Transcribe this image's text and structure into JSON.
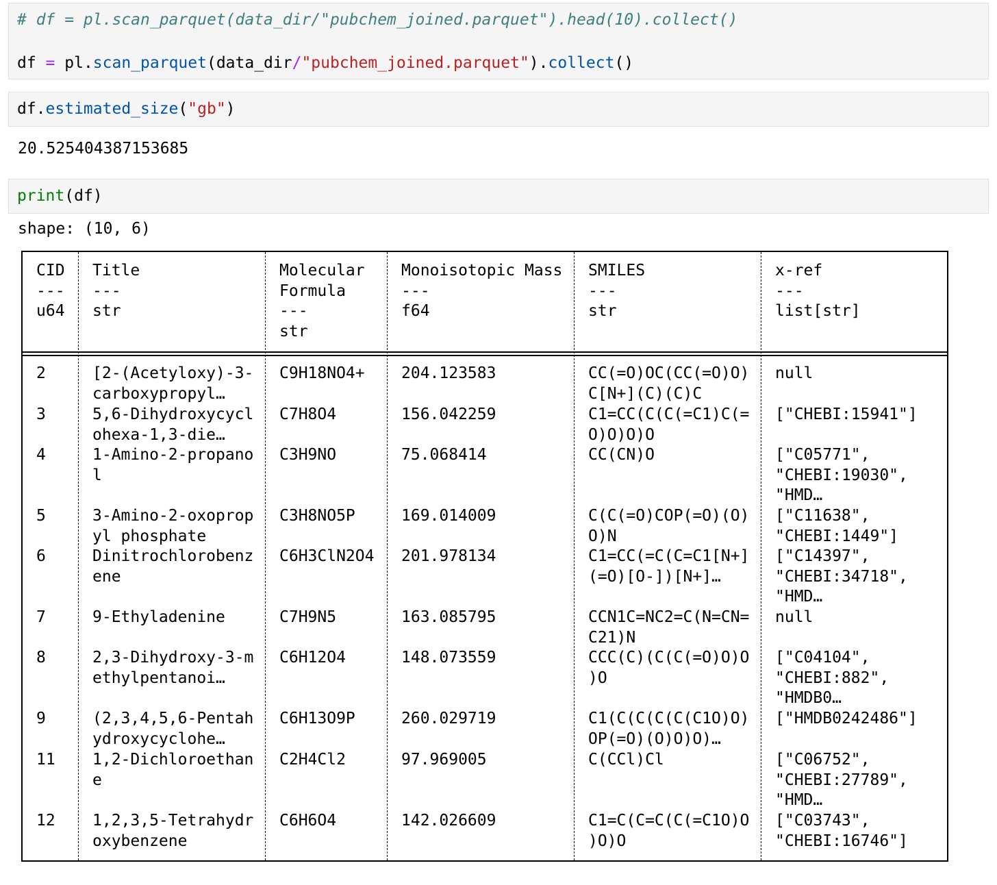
{
  "cells": [
    {
      "comment": "# df = pl.scan_parquet(data_dir/\"pubchem_joined.parquet\").head(10).collect()",
      "tokens": {
        "v": "df",
        "eq": " = ",
        "mod": "pl.",
        "fn1": "scan_parquet",
        "p1": "(data_dir",
        "slash": "/",
        "str": "\"pubchem_joined.parquet\"",
        "p2": ").",
        "fn2": "collect",
        "p3": "()"
      }
    },
    {
      "tokens": {
        "v": "df.",
        "fn": "estimated_size",
        "p1": "(",
        "str": "\"gb\"",
        "p2": ")"
      },
      "output": "20.525404387153685"
    },
    {
      "tokens": {
        "bi": "print",
        "p": "(df)"
      },
      "output": "shape: (10, 6)"
    }
  ],
  "table": {
    "headers": [
      "CID\n---\nu64",
      "Title\n---\nstr",
      "Molecular\nFormula\n---\nstr",
      "Monoisotopic Mass\n---\nf64",
      "SMILES\n---\nstr",
      "x-ref\n---\nlist[str]"
    ],
    "rows": [
      [
        "2",
        "[2-(Acetyloxy)-3-\ncarboxypropyl…",
        "C9H18NO4+",
        "204.123583",
        "CC(=O)OC(CC(=O)O)\nC[N+](C)(C)C",
        "null"
      ],
      [
        "3",
        "5,6-Dihydroxycycl\nohexa-1,3-die…",
        "C7H8O4",
        "156.042259",
        "C1=CC(C(C(=C1)C(=\nO)O)O)O",
        "[\"CHEBI:15941\"]"
      ],
      [
        "4",
        "1-Amino-2-propano\nl",
        "C3H9NO",
        "75.068414",
        "CC(CN)O",
        "[\"C05771\",\n\"CHEBI:19030\",\n\"HMD…"
      ],
      [
        "5",
        "3-Amino-2-oxoprop\nyl phosphate",
        "C3H8NO5P",
        "169.014009",
        "C(C(=O)COP(=O)(O)\nO)N",
        "[\"C11638\",\n\"CHEBI:1449\"]"
      ],
      [
        "6",
        "Dinitrochlorobenz\nene",
        "C6H3ClN2O4",
        "201.978134",
        "C1=CC(=C(C=C1[N+]\n(=O)[O-])[N+]…",
        "[\"C14397\",\n\"CHEBI:34718\",\n\"HMD…"
      ],
      [
        "7",
        "9-Ethyladenine",
        "C7H9N5",
        "163.085795",
        "CCN1C=NC2=C(N=CN=\nC21)N",
        "null"
      ],
      [
        "8",
        "2,3-Dihydroxy-3-m\nethylpentanoi…",
        "C6H12O4",
        "148.073559",
        "CCC(C)(C(C(=O)O)O\n)O",
        "[\"C04104\",\n\"CHEBI:882\",\n\"HMDB0…"
      ],
      [
        "9",
        "(2,3,4,5,6-Pentah\nydroxycyclohe…",
        "C6H13O9P",
        "260.029719",
        "C1(C(C(C(C(C1O)O)\nOP(=O)(O)O)O)…",
        "[\"HMDB0242486\"]"
      ],
      [
        "11",
        "1,2-Dichloroethan\ne",
        "C2H4Cl2",
        "97.969005",
        "C(CCl)Cl",
        "[\"C06752\",\n\"CHEBI:27789\",\n\"HMD…"
      ],
      [
        "12",
        "1,2,3,5-Tetrahydr\noxybenzene",
        "C6H6O4",
        "142.026609",
        "C1=C(C=C(C(=C1O)O\n)O)O",
        "[\"C03743\",\n\"CHEBI:16746\"]"
      ]
    ]
  }
}
